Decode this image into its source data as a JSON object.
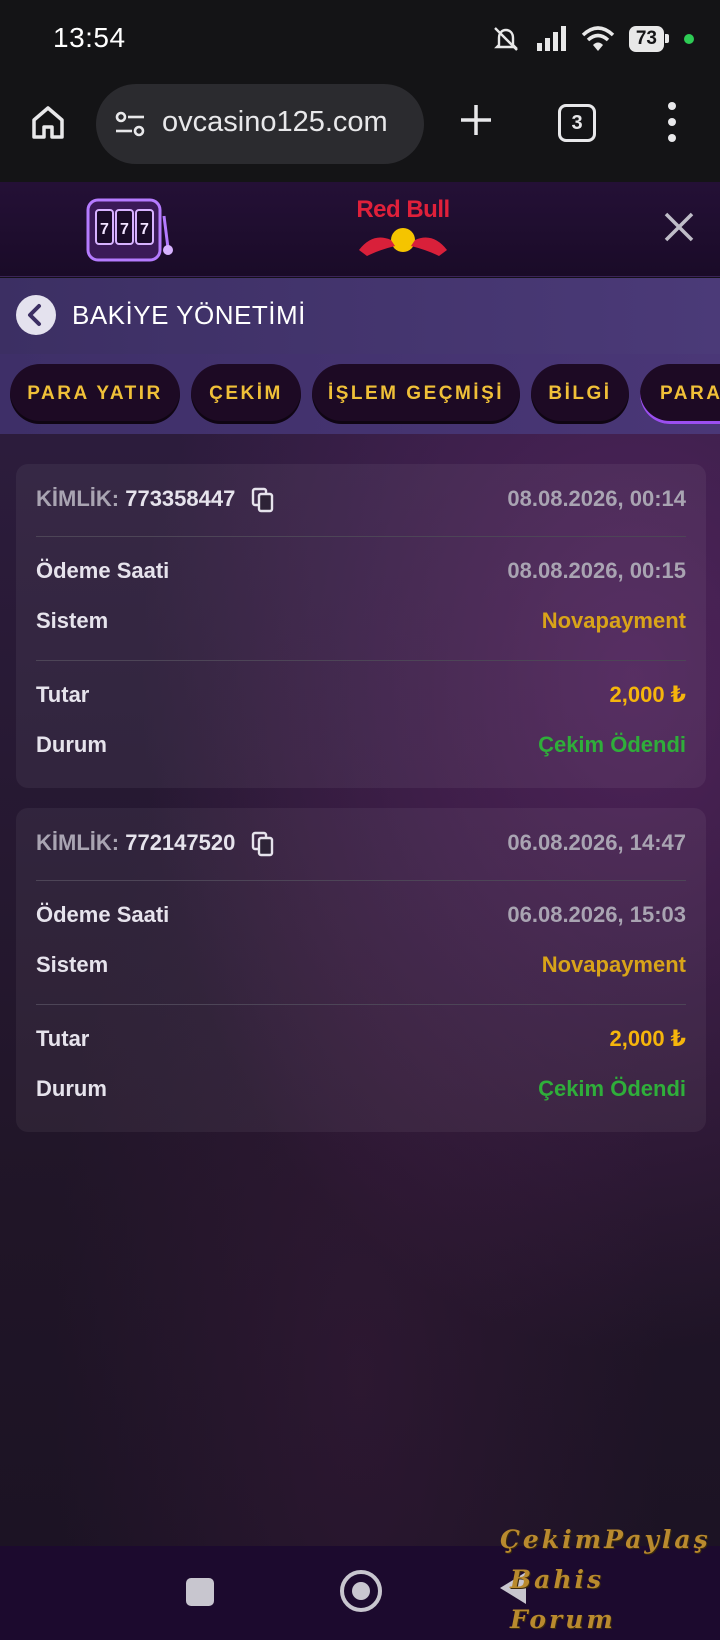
{
  "status_bar": {
    "time": "13:54",
    "battery": "73"
  },
  "browser": {
    "url": "ovcasino125.com",
    "tab_count": "3"
  },
  "header": {
    "logo": "Red Bull"
  },
  "page": {
    "title": "BAKİYE YÖNETİMİ"
  },
  "tabs": [
    {
      "label": "PARA YATIR"
    },
    {
      "label": "ÇEKİM"
    },
    {
      "label": "İŞLEM GEÇMİŞİ"
    },
    {
      "label": "BİLGİ"
    },
    {
      "label": "PARA"
    }
  ],
  "transactions": [
    {
      "id_label": "KİMLİK:",
      "id": "773358447",
      "date": "08.08.2026, 00:14",
      "payment_time_label": "Ödeme Saati",
      "payment_time": "08.08.2026, 00:15",
      "system_label": "Sistem",
      "system": "Novapayment",
      "amount_label": "Tutar",
      "amount": "2,000 ₺",
      "status_label": "Durum",
      "status": "Çekim Ödendi"
    },
    {
      "id_label": "KİMLİK:",
      "id": "772147520",
      "date": "06.08.2026, 14:47",
      "payment_time_label": "Ödeme Saati",
      "payment_time": "06.08.2026, 15:03",
      "system_label": "Sistem",
      "system": "Novapayment",
      "amount_label": "Tutar",
      "amount": "2,000 ₺",
      "status_label": "Durum",
      "status": "Çekim Ödendi"
    }
  ],
  "watermark": {
    "line1": "ÇekimPaylaş",
    "line2": "Bahis Forum"
  },
  "colors": {
    "accent_gold": "#f0c038",
    "status_green": "#2fae3a",
    "amount_gold": "#f5b50c"
  }
}
